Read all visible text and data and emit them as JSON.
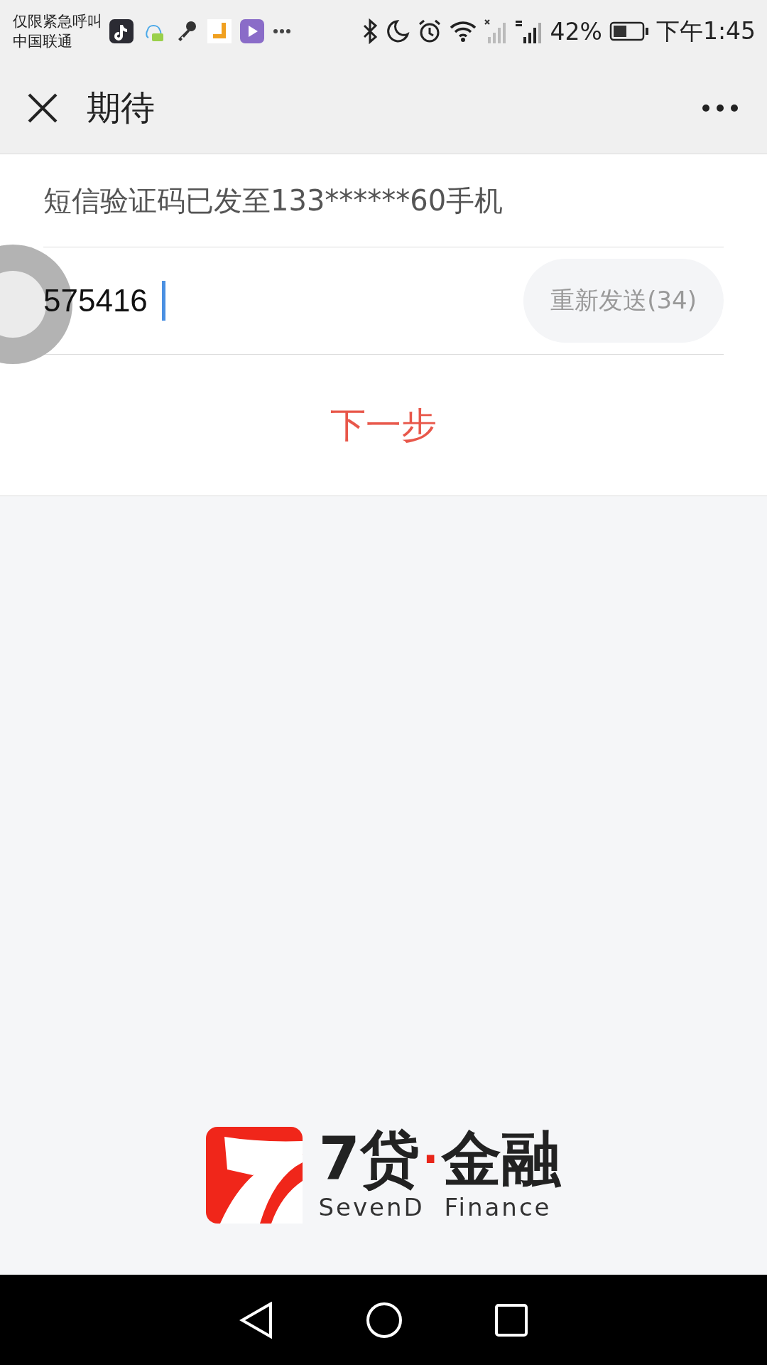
{
  "status_bar": {
    "carrier_notice": "仅限紧急呼叫",
    "carrier": "中国联通",
    "battery": "42%",
    "time": "下午1:45"
  },
  "title_bar": {
    "title": "期待"
  },
  "verify_form": {
    "message": "短信验证码已发至133******60手机",
    "code_input": {
      "value": "575416"
    },
    "resend_button": {
      "label": "重新发送(34)",
      "disabled": true
    },
    "next_button": {
      "label": "下一步"
    }
  },
  "logo": {
    "brand": "7贷",
    "dot": "·",
    "brand_suffix": "金融",
    "name_en": "SevenD Finance"
  }
}
